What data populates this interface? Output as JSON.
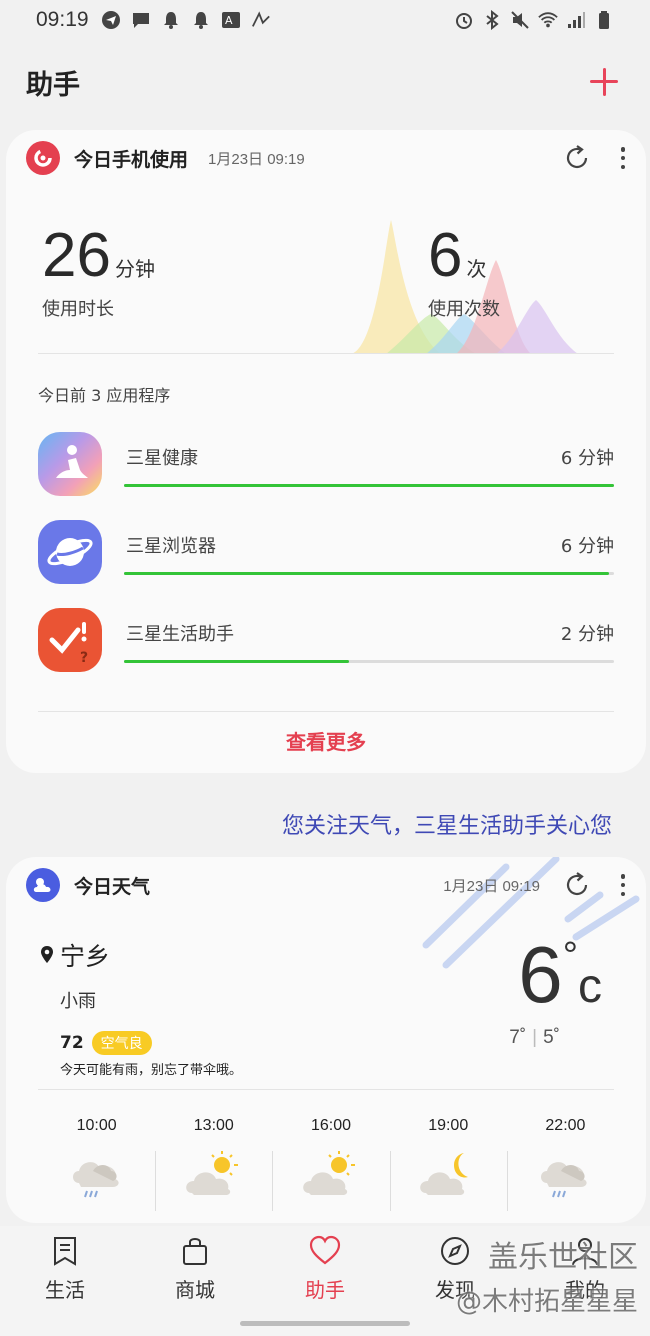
{
  "status_bar": {
    "time": "09:19"
  },
  "header": {
    "title": "助手"
  },
  "usage_card": {
    "title": "今日手机使用",
    "date": "1月23日 09:19",
    "duration_value": "26",
    "duration_unit": "分钟",
    "duration_label": "使用时长",
    "count_value": "6",
    "count_unit": "次",
    "count_label": "使用次数",
    "section_label": "今日前 3 应用程序",
    "apps": [
      {
        "name": "三星健康",
        "time": "6 分钟",
        "progress": 1.0
      },
      {
        "name": "三星浏览器",
        "time": "6 分钟",
        "progress": 0.99
      },
      {
        "name": "三星生活助手",
        "time": "2 分钟",
        "progress": 0.46
      }
    ],
    "see_more": "查看更多",
    "accent_color": "#e44050"
  },
  "promo_text": "您关注天气，三星生活助手关心您",
  "weather_card": {
    "title": "今日天气",
    "date": "1月23日 09:19",
    "location": "宁乡",
    "description": "小雨",
    "aqi_value": "72",
    "aqi_label": "空气良",
    "tip": "今天可能有雨，别忘了带伞哦。",
    "current_temp": "6",
    "temp_unit": "c",
    "high": "7˚",
    "low": "5˚",
    "hourly": [
      {
        "time": "10:00",
        "icon": "rain-cloud-icon"
      },
      {
        "time": "13:00",
        "icon": "partly-sunny-icon"
      },
      {
        "time": "16:00",
        "icon": "partly-sunny-icon"
      },
      {
        "time": "19:00",
        "icon": "cloudy-night-icon"
      },
      {
        "time": "22:00",
        "icon": "rain-cloud-icon"
      }
    ]
  },
  "bottom_nav": [
    {
      "label": "生活",
      "icon": "bookmark-icon"
    },
    {
      "label": "商城",
      "icon": "shopping-bag-icon"
    },
    {
      "label": "助手",
      "icon": "heart-icon",
      "active": true
    },
    {
      "label": "发现",
      "icon": "compass-icon"
    },
    {
      "label": "我的",
      "icon": "profile-icon"
    }
  ],
  "watermark": {
    "line1": "盖乐世社区",
    "line2": "@木村拓星星星"
  }
}
